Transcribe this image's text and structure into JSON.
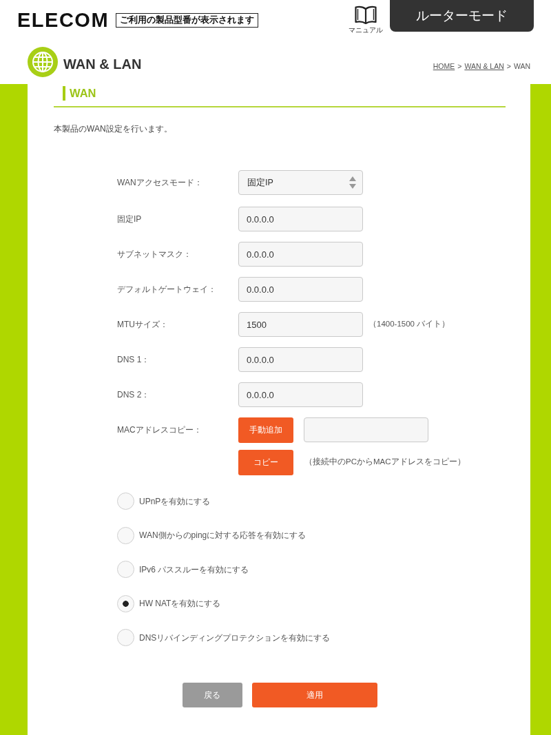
{
  "header": {
    "logo": "ELECOM",
    "model_notice": "ご利用の製品型番が表示されます",
    "manual_label": "マニュアル",
    "mode": "ルーターモード"
  },
  "page": {
    "title": "WAN & LAN",
    "breadcrumb": [
      {
        "kind": "link",
        "text": "HOME"
      },
      {
        "kind": "separator",
        "text": ">"
      },
      {
        "kind": "link",
        "text": "WAN & LAN"
      },
      {
        "kind": "separator",
        "text": ">"
      },
      {
        "kind": "current",
        "text": "WAN"
      }
    ]
  },
  "section": {
    "title": "WAN",
    "description": "本製品のWAN設定を行います。"
  },
  "fields": [
    {
      "kind": "select",
      "label": "WANアクセスモード：",
      "value": "固定IP"
    },
    {
      "kind": "text",
      "label": "固定IP",
      "value": "0.0.0.0"
    },
    {
      "kind": "text",
      "label": "サブネットマスク：",
      "value": "0.0.0.0"
    },
    {
      "kind": "text",
      "label": "デフォルトゲートウェイ：",
      "value": "0.0.0.0"
    },
    {
      "kind": "text",
      "label": "MTUサイズ：",
      "value": "1500",
      "hint": "（1400-1500 バイト）"
    },
    {
      "kind": "text",
      "label": "DNS 1：",
      "value": "0.0.0.0"
    },
    {
      "kind": "text",
      "label": "DNS 2：",
      "value": "0.0.0.0"
    }
  ],
  "mac_copy": {
    "label": "MACアドレスコピー：",
    "manual_button": "手動追加",
    "copy_button": "コピー",
    "copy_hint": "（接続中のPCからMACアドレスをコピー）"
  },
  "options": [
    {
      "label": "UPnPを有効にする",
      "checked": false
    },
    {
      "label": "WAN側からのpingに対する応答を有効にする",
      "checked": false
    },
    {
      "label": "IPv6 パススルーを有効にする",
      "checked": false
    },
    {
      "label": "HW NATを有効にする",
      "checked": true
    },
    {
      "label": "DNSリバインディングプロテクションを有効にする",
      "checked": false
    }
  ],
  "buttons": [
    {
      "kind": "secondary",
      "label": "戻る"
    },
    {
      "kind": "primary",
      "label": "適用"
    }
  ]
}
